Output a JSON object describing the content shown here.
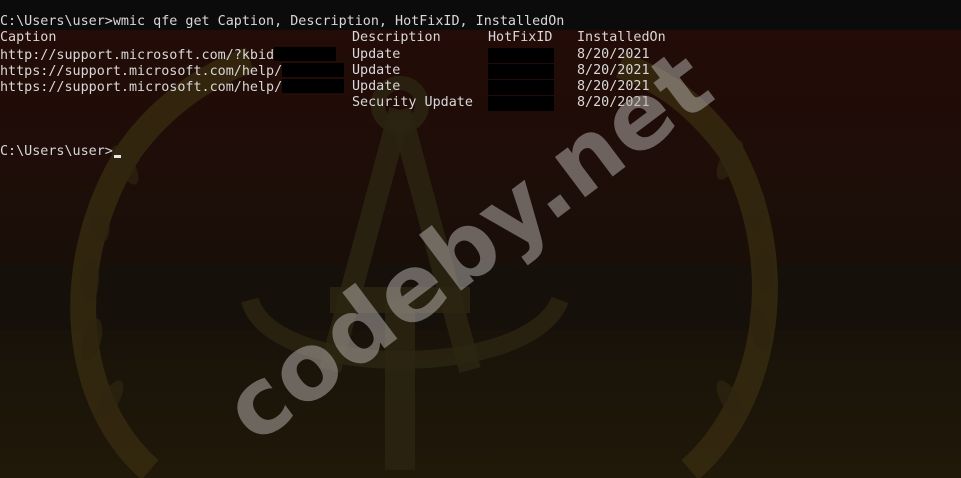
{
  "terminal": {
    "command_line": "C:\\Users\\user>wmic qfe get Caption, Description, HotFixID, InstalledOn",
    "headers": {
      "caption": "Caption",
      "description": "Description",
      "hotfixid": "HotFixID",
      "installedon": "InstalledOn"
    },
    "rows": [
      {
        "caption": "http://support.microsoft.com/?kbid",
        "description": "Update",
        "hotfixid": "",
        "installedon": "8/20/2021"
      },
      {
        "caption": "https://support.microsoft.com/help/",
        "description": "Update",
        "hotfixid": "",
        "installedon": "8/20/2021"
      },
      {
        "caption": "https://support.microsoft.com/help/",
        "description": "Update",
        "hotfixid": "",
        "installedon": "8/20/2021"
      },
      {
        "caption": "",
        "description": "Security Update",
        "hotfixid": "",
        "installedon": "8/20/2021"
      }
    ],
    "prompt": "C:\\Users\\user>"
  },
  "watermark": "codeby.net",
  "colors": {
    "background": "#0c0c0c",
    "text": "#d8d8d8",
    "watermark": "#afaaa5"
  },
  "icons": {
    "background_emblem": "compass-hammer-wreath-emblem"
  }
}
